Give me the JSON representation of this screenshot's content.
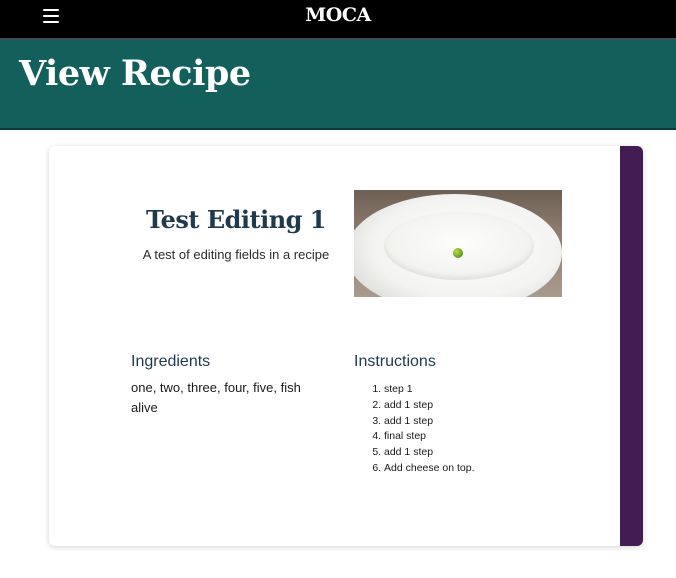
{
  "header": {
    "brand": "MOCA",
    "menu_icon": "hamburger-menu-icon"
  },
  "hero": {
    "title": "View Recipe"
  },
  "recipe": {
    "title": "Test Editing 1",
    "description": "A test of editing fields in a recipe",
    "image_alt": "white plate with a single green pea",
    "ingredients_heading": "Ingredients",
    "ingredients_text": "one, two, three, four, five, fish alive",
    "instructions_heading": "Instructions",
    "instructions": [
      "step 1",
      "add 1 step",
      "add 1 step",
      "final step",
      "add 1 step",
      "Add cheese on top."
    ]
  },
  "colors": {
    "topbar": "#000000",
    "hero_background": "#125f5c",
    "card_accent": "#421c52",
    "title_text": "#1f3a4d"
  }
}
